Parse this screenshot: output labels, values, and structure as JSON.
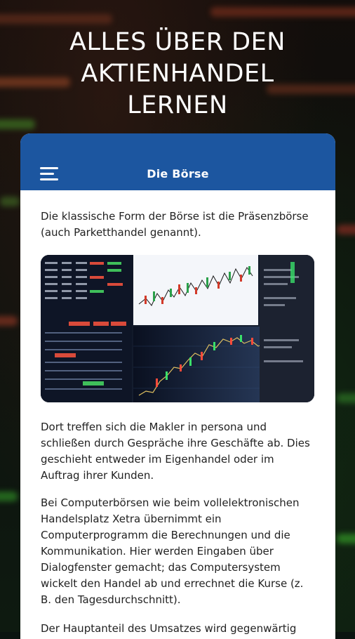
{
  "headline": {
    "lines": [
      "ALLES ÜBER DEN",
      "AKTIENHANDEL",
      "LERNEN"
    ]
  },
  "app_bar": {
    "menu_icon": "hamburger-menu-icon",
    "title": "Die Börse",
    "color": "#1c56a0"
  },
  "article": {
    "intro": "Die klassische Form der Börse ist die Präsenzbörse (auch Parketthandel genannt).",
    "image_subject": "trading-screens-photo",
    "paragraphs": [
      "Dort treffen sich die Makler in persona und schließen durch Gespräche ihre Geschäfte ab. Dies geschieht entweder im Eigenhandel oder im Auftrag ihrer Kunden.",
      "Bei Computerbörsen wie beim vollelektronischen Handelsplatz Xetra übernimmt ein Computerprogramm die Berechnungen und die Kommunikation. Hier werden Eingaben über Dialogfenster gemacht; das Computersystem wickelt den Handel ab und errechnet die Kurse (z. B. den Tagesdurchschnitt).",
      "Der Hauptanteil des Umsatzes wird gegenwärtig"
    ]
  }
}
